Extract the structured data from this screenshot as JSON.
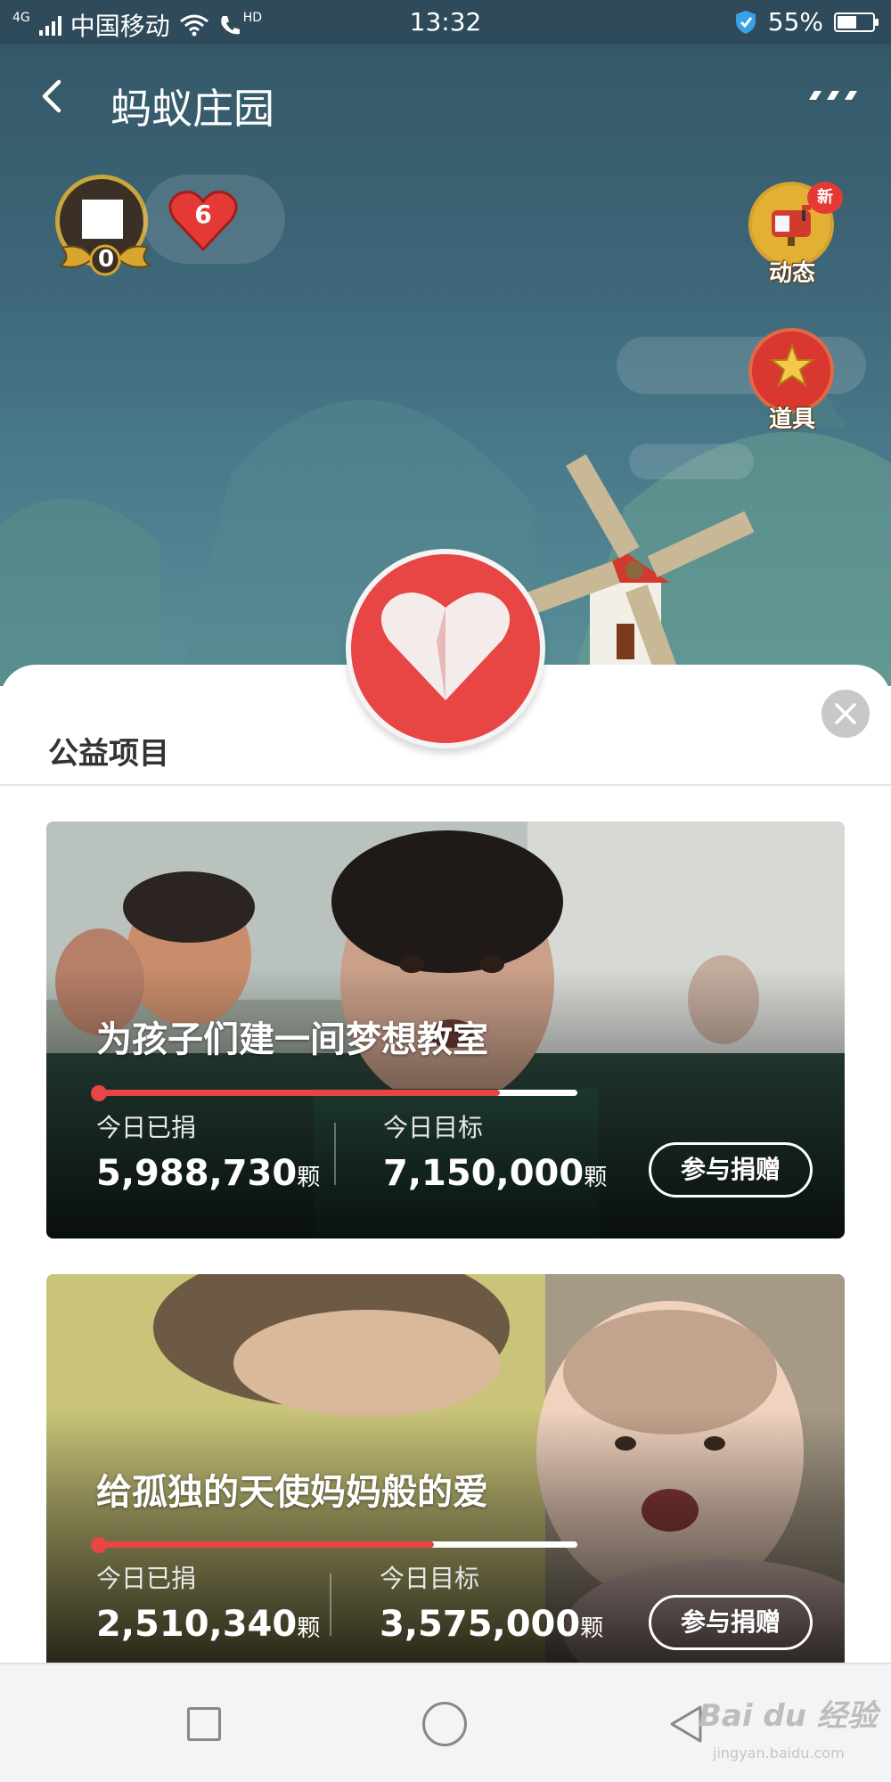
{
  "status_bar": {
    "network": "4G",
    "carrier": "中国移动",
    "hd": "HD",
    "time": "13:32",
    "battery": "55%",
    "battery_level": 0.55
  },
  "navbar": {
    "title": "蚂蚁庄园"
  },
  "profile": {
    "level": "0",
    "hearts": "6"
  },
  "side_buttons": {
    "dynamics_label": "动态",
    "dynamics_badge": "新",
    "props_label": "道具"
  },
  "sheet": {
    "title": "公益项目"
  },
  "projects": [
    {
      "title": "为孩子们建一间梦想教室",
      "donated_label": "今日已捐",
      "donated": "5,988,730",
      "target_label": "今日目标",
      "target": "7,150,000",
      "unit": "颗",
      "button": "参与捐赠",
      "progress": 0.838
    },
    {
      "title": "给孤独的天使妈妈般的爱",
      "donated_label": "今日已捐",
      "donated": "2,510,340",
      "target_label": "今日目标",
      "target": "3,575,000",
      "unit": "颗",
      "button": "参与捐赠",
      "progress": 0.702
    }
  ],
  "watermark": {
    "logo_text": "Bai du 经验",
    "site": "jingyan.baidu.com"
  },
  "colors": {
    "accent_red": "#e84545",
    "status_bar_bg": "#2f4a5a",
    "hero_bg": "#3d6678"
  }
}
